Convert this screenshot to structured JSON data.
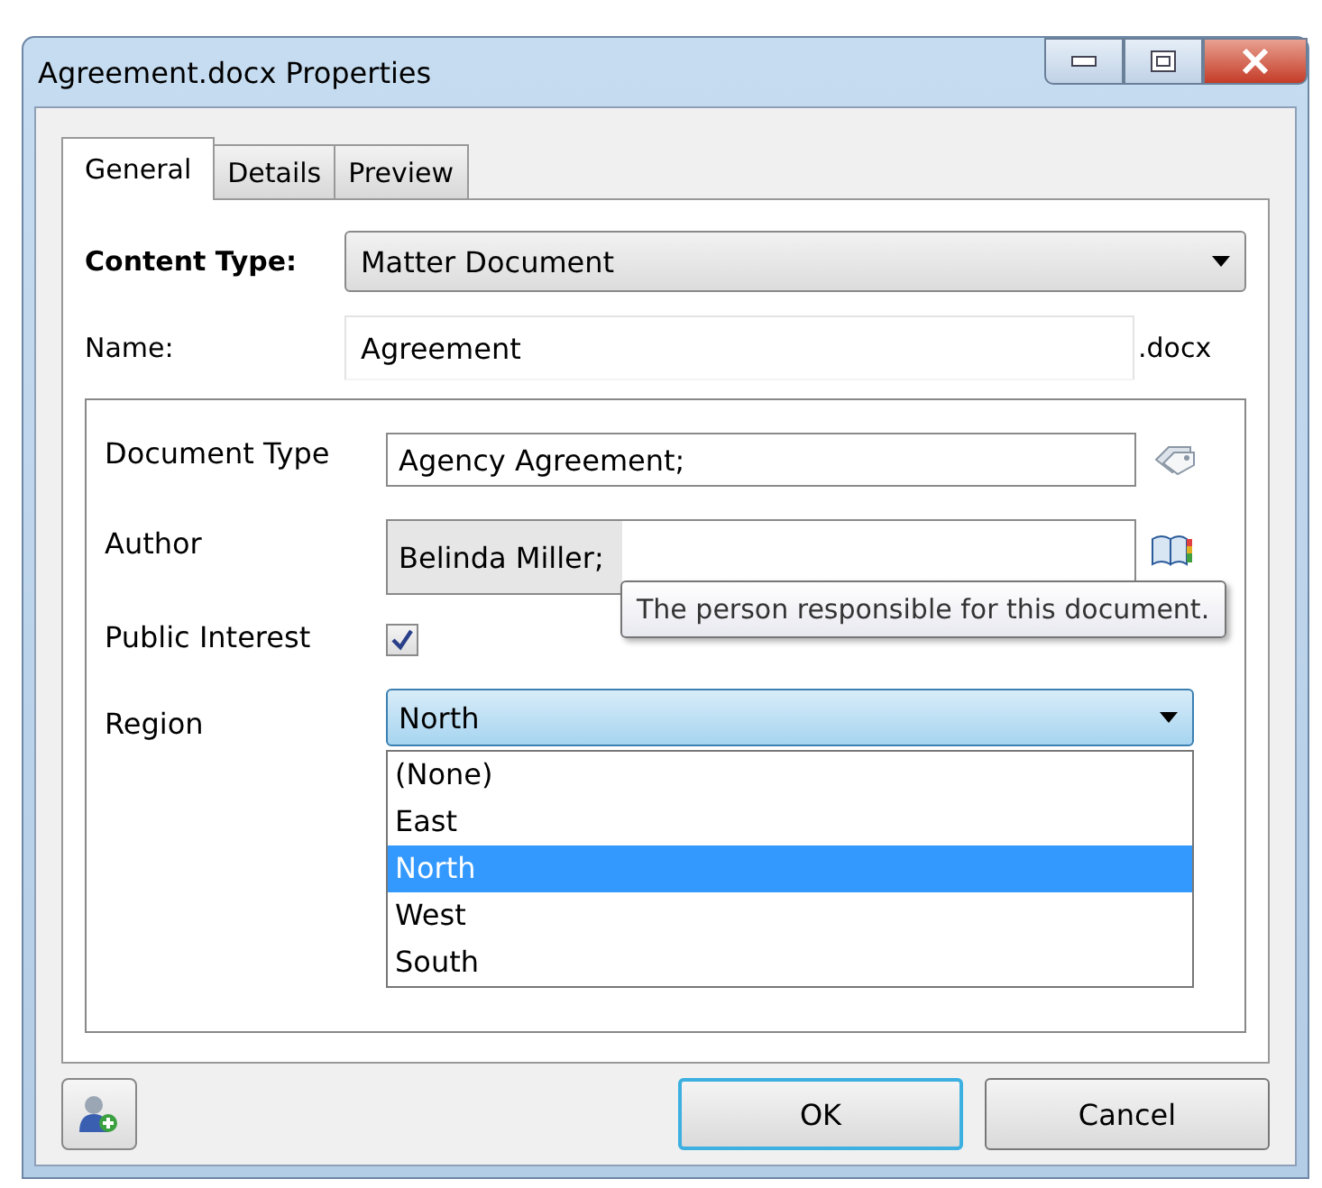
{
  "window": {
    "title": "Agreement.docx Properties"
  },
  "tabs": [
    {
      "label": "General",
      "selected": true
    },
    {
      "label": "Details",
      "selected": false
    },
    {
      "label": "Preview",
      "selected": false
    }
  ],
  "content_type": {
    "label": "Content Type:",
    "value": "Matter Document"
  },
  "name": {
    "label": "Name:",
    "value": "Agreement",
    "extension": ".docx"
  },
  "properties": [
    {
      "kind": "text",
      "label": "Document Type",
      "value": "Agency Agreement;"
    },
    {
      "kind": "person",
      "label": "Author",
      "value": "Belinda Miller;",
      "tooltip": "The person responsible for this document."
    },
    {
      "kind": "checkbox",
      "label": "Public Interest",
      "checked": true
    },
    {
      "kind": "choice",
      "label": "Region",
      "value": "North",
      "expanded": true,
      "options": [
        {
          "label": "(None)",
          "selected": false
        },
        {
          "label": "East",
          "selected": false
        },
        {
          "label": "North",
          "selected": true
        },
        {
          "label": "West",
          "selected": false
        },
        {
          "label": "South",
          "selected": false
        }
      ]
    }
  ],
  "buttons": [
    "OK",
    "Cancel"
  ]
}
